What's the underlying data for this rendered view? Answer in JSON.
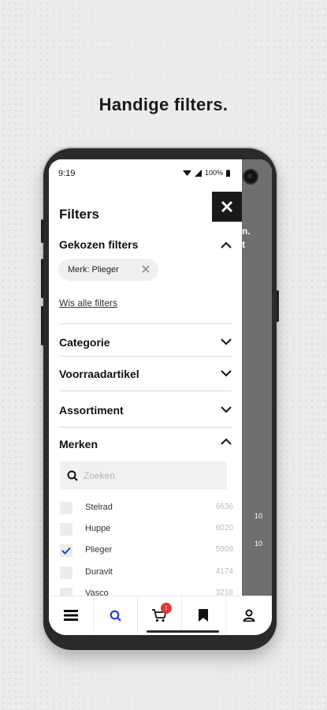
{
  "headline": "Handige filters.",
  "status_bar": {
    "time": "9:19",
    "battery": "100%"
  },
  "filter_panel": {
    "title": "Filters",
    "chosen_filters": {
      "title": "Gekozen filters",
      "chips": [
        {
          "label": "Merk: Plieger"
        }
      ],
      "clear_all_label": "Wis alle filters"
    },
    "sections": [
      {
        "title": "Categorie",
        "expanded": false
      },
      {
        "title": "Voorraadartikel",
        "expanded": false
      },
      {
        "title": "Assortiment",
        "expanded": false
      },
      {
        "title": "Merken",
        "expanded": true
      }
    ],
    "brand_search": {
      "placeholder": "Zoeken"
    },
    "brands": [
      {
        "name": "Stelrad",
        "count": "6636",
        "checked": false
      },
      {
        "name": "Huppe",
        "count": "6020",
        "checked": false
      },
      {
        "name": "Plieger",
        "count": "5909",
        "checked": true
      },
      {
        "name": "Duravit",
        "count": "4174",
        "checked": false
      },
      {
        "name": "Vasco",
        "count": "3218",
        "checked": false
      }
    ]
  },
  "background_page": {
    "text_1": "n.",
    "text_2": "t",
    "num_1": "10",
    "num_2": "10"
  },
  "bottom_nav": {
    "items": [
      "menu-icon",
      "search-icon",
      "cart-icon",
      "bookmark-icon",
      "account-icon"
    ],
    "cart_badge": "1",
    "active_color": "#1e3fd8"
  },
  "colors": {
    "accent": "#1e3fd8",
    "badge": "#e53935",
    "close_bg": "#1a1a1a"
  }
}
